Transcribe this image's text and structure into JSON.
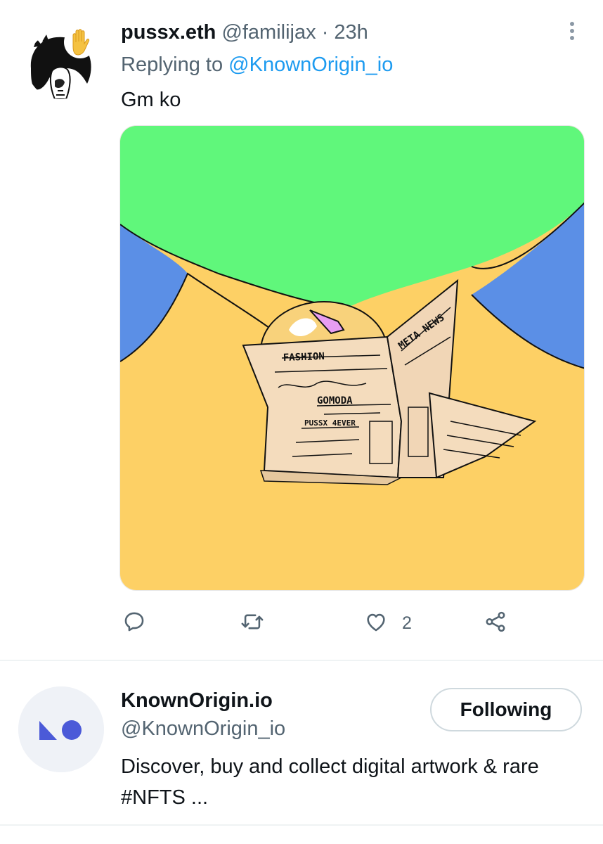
{
  "tweet": {
    "display_name": "pussx.eth",
    "handle": "@familijax",
    "separator": "·",
    "time": "23h",
    "replying_prefix": "Replying to",
    "replying_to": "@KnownOrigin_io",
    "text": "Gm ko",
    "avatar_icon": "hand-raised-emoji",
    "media_artwork_text": [
      "FASHION",
      "META NEWS",
      "GOMODA",
      "PUSSX 4EVER"
    ],
    "actions": {
      "reply_icon": "reply-icon",
      "retweet_icon": "retweet-icon",
      "like_icon": "heart-icon",
      "like_count": "2",
      "share_icon": "share-icon"
    },
    "colors": {
      "link": "#1d9bf0",
      "muted": "#536471"
    }
  },
  "account": {
    "name": "KnownOrigin.io",
    "handle": "@KnownOrigin_io",
    "follow_label": "Following",
    "bio": "Discover, buy and collect digital artwork & rare #NFTS ...",
    "logo_color": "#4b5ad8"
  }
}
